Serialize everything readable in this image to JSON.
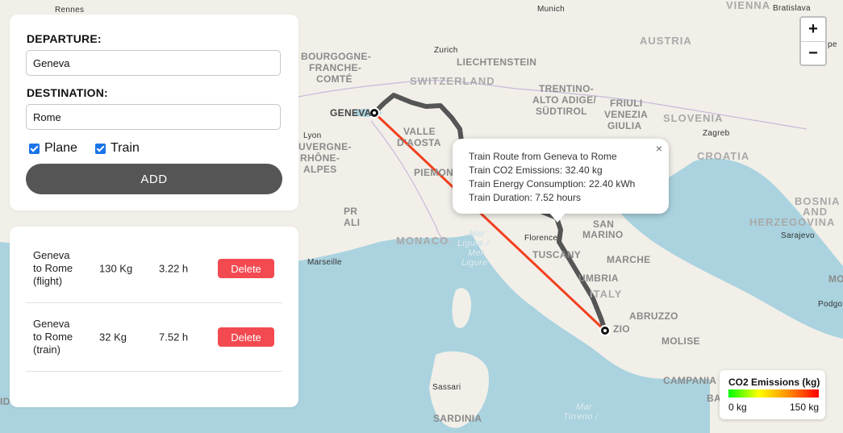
{
  "form": {
    "departure_label": "DEPARTURE:",
    "departure_value": "Geneva",
    "destination_label": "DESTINATION:",
    "destination_value": "Rome",
    "plane_label": "Plane",
    "plane_checked": true,
    "train_label": "Train",
    "train_checked": true,
    "add_label": "ADD"
  },
  "routes": [
    {
      "name_line1": "Geneva",
      "name_line2": "to Rome",
      "name_line3": "(flight)",
      "co2": "130 Kg",
      "duration": "3.22 h",
      "delete_label": "Delete"
    },
    {
      "name_line1": "Geneva",
      "name_line2": "to Rome",
      "name_line3": "(train)",
      "co2": "32 Kg",
      "duration": "7.52 h",
      "delete_label": "Delete"
    }
  ],
  "zoom": {
    "in_label": "+",
    "out_label": "−"
  },
  "popup": {
    "close_label": "×",
    "line1": "Train Route from Geneva to Rome",
    "line2": "Train CO2 Emissions: 32.40 kg",
    "line3": "Train Energy Consumption: 22.40 kWh",
    "line4": "Train Duration: 7.52 hours"
  },
  "legend": {
    "title": "CO2 Emissions (kg)",
    "min_label": "0 kg",
    "max_label": "150 kg",
    "colors": [
      "#00ff00",
      "#ffff00",
      "#ff8c00",
      "#ff0000"
    ]
  },
  "map_labels": {
    "rennes": "Rennes",
    "munich": "Munich",
    "vienna": "VIENNA",
    "bratislava": "Bratislava",
    "zurich": "Zurich",
    "austria": "AUSTRIA",
    "bourgogne": "BOURGOGNE-",
    "franche": "FRANCHE-",
    "comte": "COMTÉ",
    "liechtenstein": "LIECHTENSTEIN",
    "switzerland": "SWITZERLAND",
    "trentino1": "TRENTINO-",
    "trentino2": "ALTO ADIGE/",
    "trentino3": "SÜDTIROL",
    "friuli1": "FRIULI",
    "friuli2": "VENEZIA",
    "friuli3": "GIULIA",
    "slovenia": "SLOVENIA",
    "geneva": "GENEVA",
    "lyon": "Lyon",
    "valle1": "VALLE",
    "valle2": "D'AOSTA",
    "auvergne1": "UVERGNE-",
    "auvergne2": "RHÔNE-",
    "auvergne3": "ALPES",
    "zagreb": "Zagreb",
    "croatia": "CROATIA",
    "piemonte": "PIEMON",
    "pr": "PR",
    "ali": "ALI",
    "bosnia1": "BOSNIA",
    "bosnia2": "AND",
    "bosnia3": "HERZEGOVINA",
    "sarajevo": "Sarajevo",
    "monaco": "MONACO",
    "mar1": "Mar",
    "mar2": "Ligure /",
    "mar3": "Mer",
    "mar4": "Ligure",
    "florence": "Florence",
    "san1": "SAN",
    "san2": "MARINO",
    "marseille": "Marseille",
    "tuscany": "TUSCANY",
    "marche": "MARCHE",
    "umbria": "UMBRIA",
    "italy": "ITALY",
    "podgo": "Podgo",
    "abruzzo": "ABRUZZO",
    "lazio": "ZIO",
    "molise": "MOLISE",
    "campania": "CAMPANIA",
    "ba": "BA",
    "sassari": "Sassari",
    "sardinia": "SARDINIA",
    "tirreno1": "Mar",
    "tirreno2": "Tirreno /",
    "id": "ID",
    "mo": "MO",
    "pe": "pe"
  },
  "map_colors": {
    "land": "#f2efe9",
    "sea": "#aad3df",
    "train_route": "#555555",
    "flight_route": "#f2401f"
  }
}
